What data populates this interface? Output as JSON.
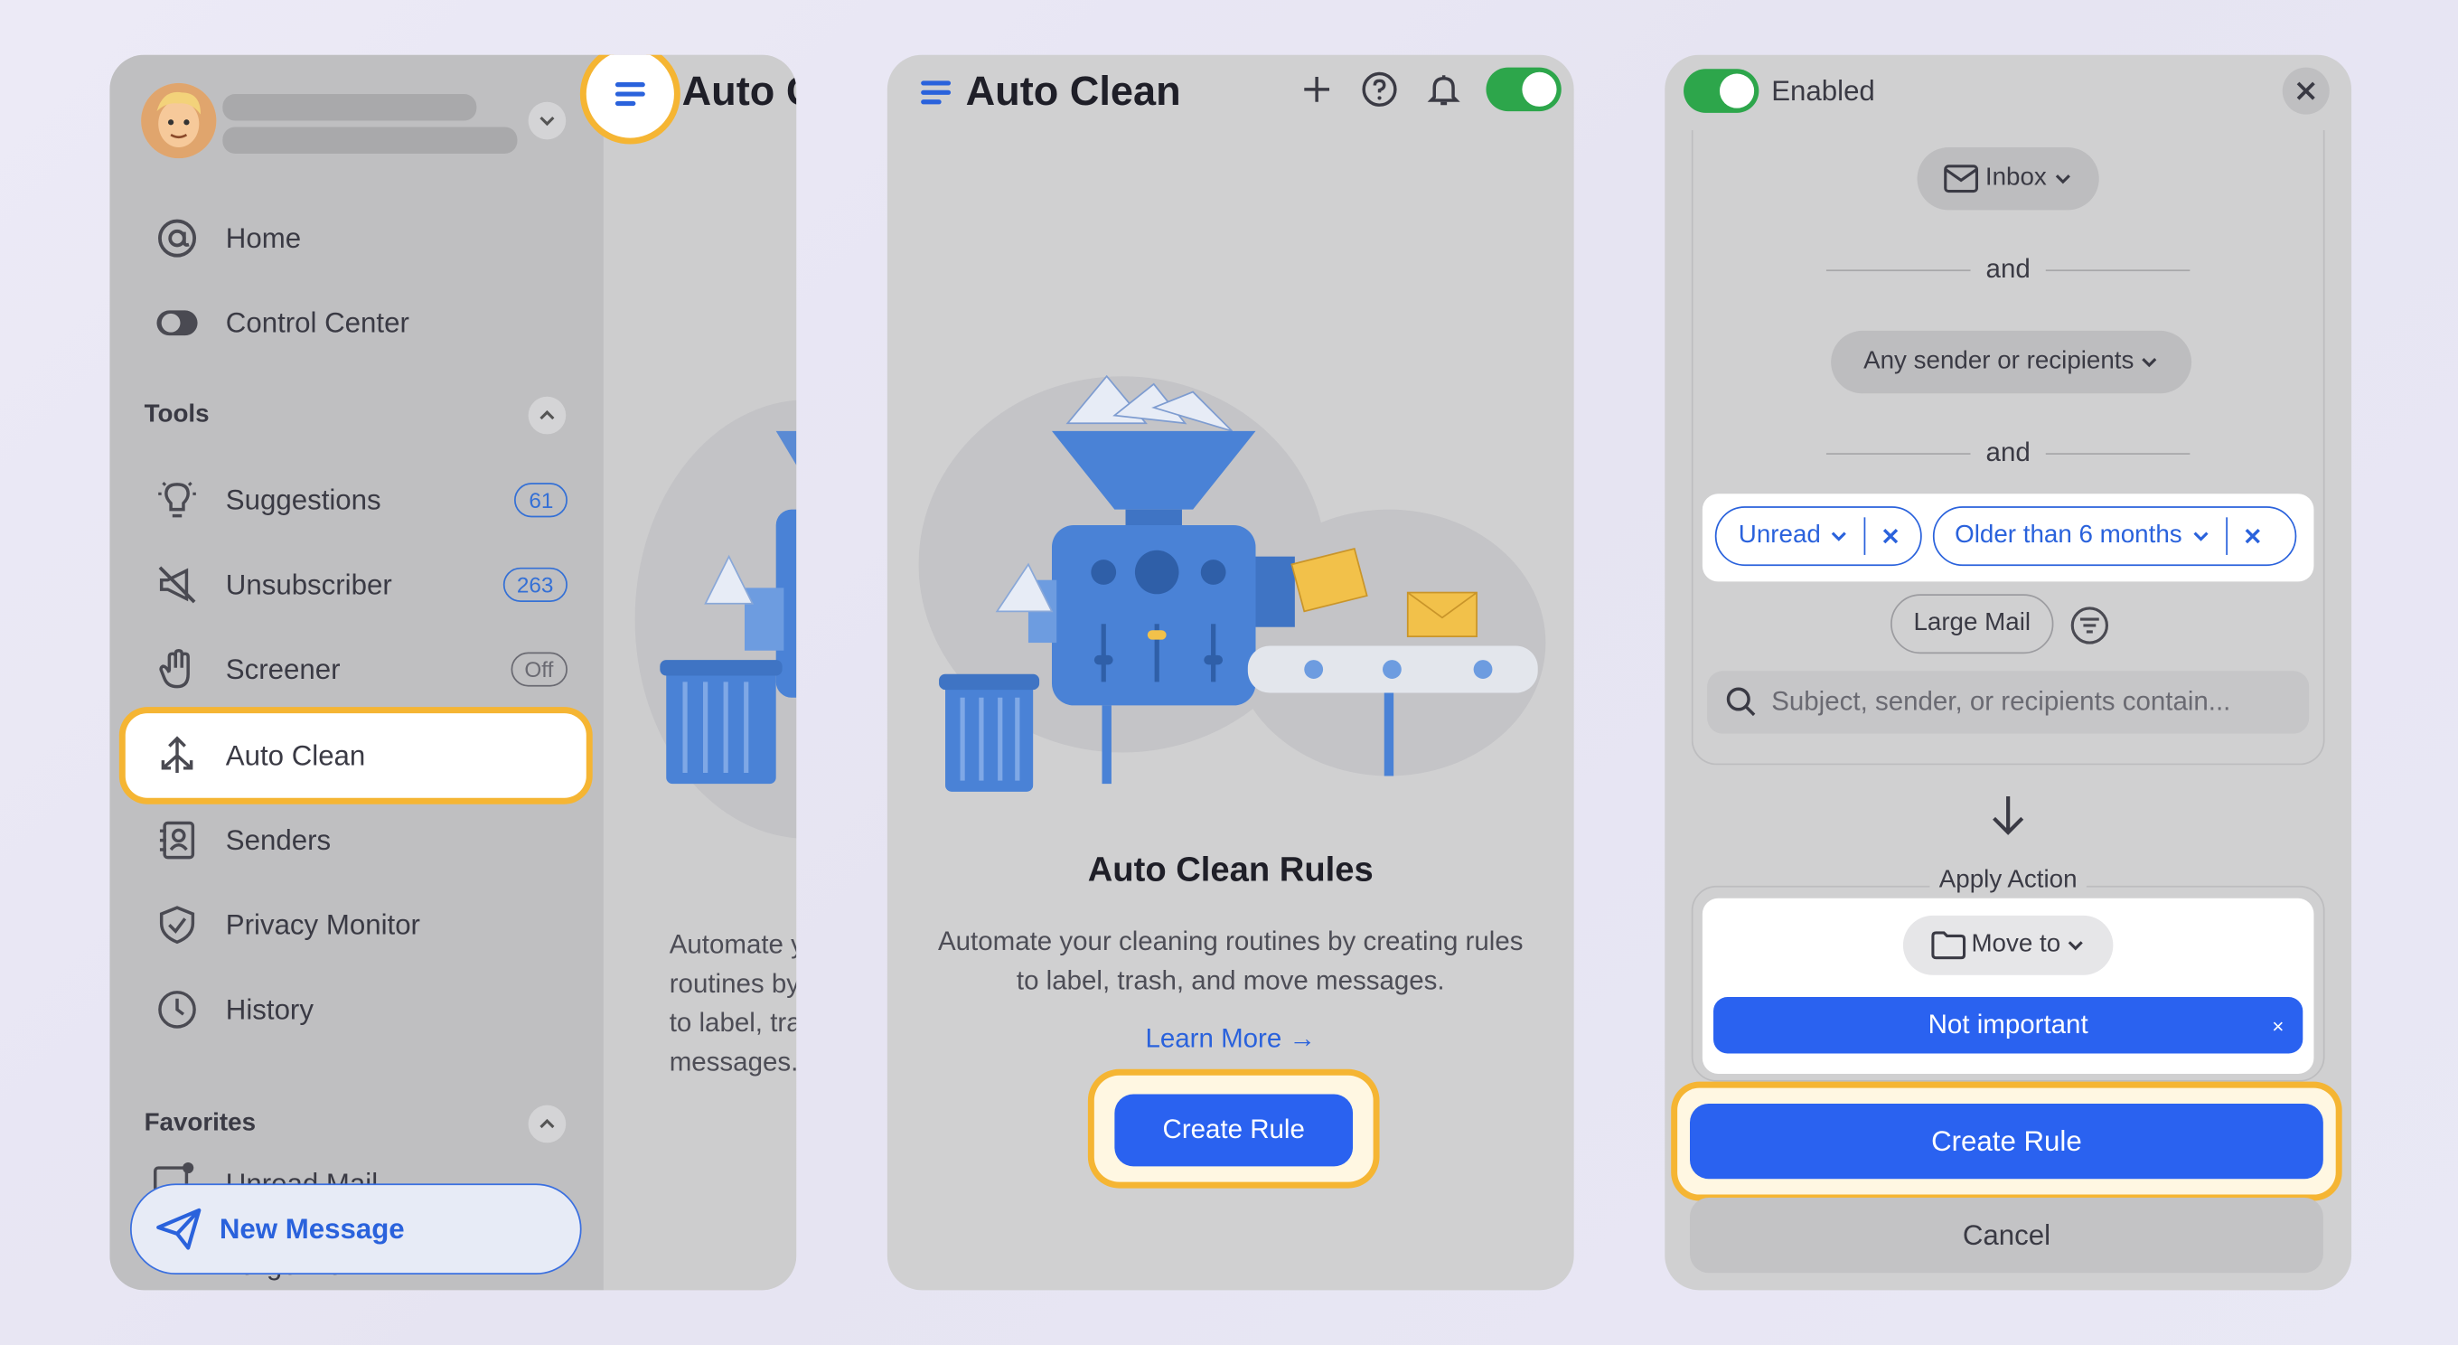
{
  "panel1": {
    "sidebar": {
      "items": [
        {
          "label": "Home",
          "icon": "at-icon"
        },
        {
          "label": "Control Center",
          "icon": "toggle-icon"
        },
        {
          "label": "Suggestions",
          "icon": "lightbulb-icon",
          "badge": "61"
        },
        {
          "label": "Unsubscriber",
          "icon": "megaphone-off-icon",
          "badge": "263"
        },
        {
          "label": "Screener",
          "icon": "hand-icon",
          "badge": "Off"
        },
        {
          "label": "Auto Clean",
          "icon": "arrows-icon"
        },
        {
          "label": "Senders",
          "icon": "contacts-icon"
        },
        {
          "label": "Privacy Monitor",
          "icon": "shield-icon"
        },
        {
          "label": "History",
          "icon": "clock-icon"
        }
      ],
      "tools_label": "Tools",
      "favorites_label": "Favorites",
      "favorites_partial": "Unread Mail",
      "favorites_partial2": "Large Mail",
      "new_message": "New Message"
    },
    "title_partial": "Auto Clean",
    "desc_partial": "Automate your cleaning routines by creating rules to label, trash, and move messages."
  },
  "panel2": {
    "title": "Auto Clean",
    "heading": "Auto Clean Rules",
    "description": "Automate your cleaning routines by creating rules to label, trash, and move messages.",
    "learn_more": "Learn More →",
    "create_rule": "Create Rule"
  },
  "panel3": {
    "enabled_label": "Enabled",
    "inbox": "Inbox",
    "and1": "and",
    "any_sender": "Any sender or recipients",
    "and2": "and",
    "tag_unread": "Unread",
    "tag_older": "Older than 6 months",
    "large_mail": "Large Mail",
    "search_placeholder": "Subject, sender, or recipients contain...",
    "apply_action": "Apply Action",
    "move_to": "Move to",
    "not_important": "Not important",
    "not_important_x": "×",
    "create_rule": "Create Rule",
    "cancel": "Cancel"
  },
  "colors": {
    "accent": "#2a62f0",
    "highlight": "#f5b533",
    "toggle_on": "#2da64b"
  }
}
